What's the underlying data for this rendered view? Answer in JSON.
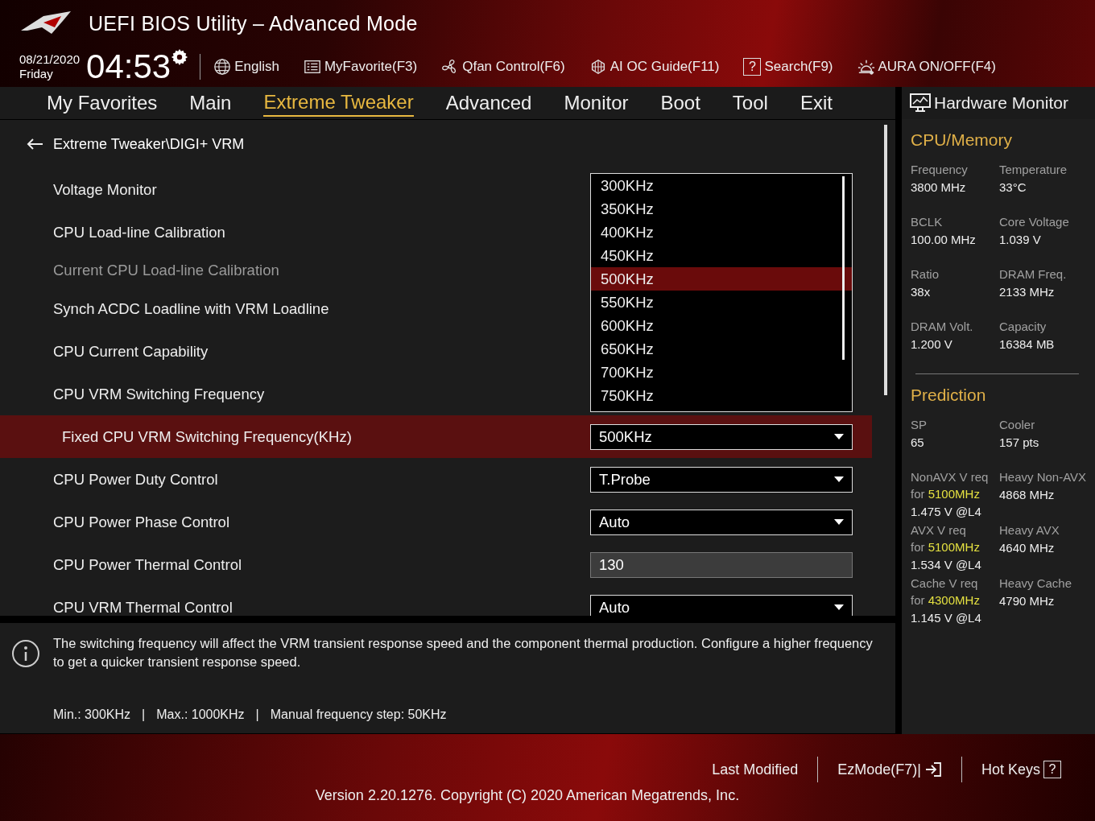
{
  "window": {
    "title": "UEFI BIOS Utility – Advanced Mode"
  },
  "clock": {
    "date": "08/21/2020",
    "day": "Friday",
    "time": "04:53"
  },
  "toolbar": [
    {
      "label": "English"
    },
    {
      "label": "MyFavorite(F3)"
    },
    {
      "label": "Qfan Control(F6)"
    },
    {
      "label": "AI OC Guide(F11)"
    },
    {
      "label": "Search(F9)",
      "glyph": "?"
    },
    {
      "label": "AURA ON/OFF(F4)"
    }
  ],
  "tabs": [
    {
      "label": "My Favorites",
      "selected": false
    },
    {
      "label": "Main",
      "selected": false
    },
    {
      "label": "Extreme Tweaker",
      "selected": true
    },
    {
      "label": "Advanced",
      "selected": false
    },
    {
      "label": "Monitor",
      "selected": false
    },
    {
      "label": "Boot",
      "selected": false
    },
    {
      "label": "Tool",
      "selected": false
    },
    {
      "label": "Exit",
      "selected": false
    }
  ],
  "breadcrumb": "Extreme Tweaker\\DIGI+ VRM",
  "settings": [
    {
      "label": "Voltage Monitor",
      "kind": "hidden",
      "selected": false,
      "disabled": false
    },
    {
      "label": "CPU Load-line Calibration",
      "kind": "hidden",
      "selected": false,
      "disabled": false
    },
    {
      "label": "Current CPU Load-line Calibration",
      "kind": "hidden",
      "selected": false,
      "disabled": true
    },
    {
      "label": "Synch ACDC Loadline with VRM Loadline",
      "kind": "hidden",
      "selected": false,
      "disabled": false
    },
    {
      "label": "CPU Current Capability",
      "kind": "hidden",
      "selected": false,
      "disabled": false
    },
    {
      "label": "CPU VRM Switching Frequency",
      "kind": "hidden",
      "selected": false,
      "disabled": false
    },
    {
      "label": "Fixed CPU VRM Switching Frequency(KHz)",
      "kind": "dropdown",
      "value": "500KHz",
      "selected": true,
      "disabled": false
    },
    {
      "label": "CPU Power Duty Control",
      "kind": "dropdown",
      "value": "T.Probe",
      "selected": false,
      "disabled": false
    },
    {
      "label": "CPU Power Phase Control",
      "kind": "dropdown",
      "value": "Auto",
      "selected": false,
      "disabled": false
    },
    {
      "label": "CPU Power Thermal Control",
      "kind": "input",
      "value": "130",
      "selected": false,
      "disabled": false
    },
    {
      "label": "CPU VRM Thermal Control",
      "kind": "dropdown",
      "value": "Auto",
      "selected": false,
      "disabled": false
    }
  ],
  "dropdown_list": {
    "options": [
      {
        "label": "300KHz",
        "selected": false
      },
      {
        "label": "350KHz",
        "selected": false
      },
      {
        "label": "400KHz",
        "selected": false
      },
      {
        "label": "450KHz",
        "selected": false
      },
      {
        "label": "500KHz",
        "selected": true
      },
      {
        "label": "550KHz",
        "selected": false
      },
      {
        "label": "600KHz",
        "selected": false
      },
      {
        "label": "650KHz",
        "selected": false
      },
      {
        "label": "700KHz",
        "selected": false
      },
      {
        "label": "750KHz",
        "selected": false
      }
    ]
  },
  "help": {
    "text": "The switching frequency will affect the VRM transient response speed and the component thermal production. Configure a higher frequency to get a quicker transient response speed.",
    "limits": [
      "Min.: 300KHz",
      "Max.: 1000KHz",
      "Manual frequency step: 50KHz"
    ],
    "separator": "|"
  },
  "hardware_monitor": {
    "title": "Hardware Monitor",
    "cpu_memory": {
      "title": "CPU/Memory",
      "items": [
        {
          "label": "Frequency",
          "value": "3800 MHz"
        },
        {
          "label": "Temperature",
          "value": "33°C"
        },
        {
          "label": "BCLK",
          "value": "100.00 MHz"
        },
        {
          "label": "Core Voltage",
          "value": "1.039 V"
        },
        {
          "label": "Ratio",
          "value": "38x"
        },
        {
          "label": "DRAM Freq.",
          "value": "2133 MHz"
        },
        {
          "label": "DRAM Volt.",
          "value": "1.200 V"
        },
        {
          "label": "Capacity",
          "value": "16384 MB"
        }
      ]
    },
    "prediction": {
      "title": "Prediction",
      "items": [
        {
          "label": "SP",
          "value": "65"
        },
        {
          "label": "Cooler",
          "value": "157 pts"
        }
      ],
      "rows": [
        {
          "left": {
            "label": "NonAVX V req",
            "prefix": "for",
            "target": "5100MHz",
            "value": "1.475 V @L4"
          },
          "right": {
            "label": "Heavy Non-AVX",
            "value": "4868 MHz"
          }
        },
        {
          "left": {
            "label": "AVX V req",
            "prefix": "for",
            "target": "5100MHz",
            "value": "1.534 V @L4"
          },
          "right": {
            "label": "Heavy AVX",
            "value": "4640 MHz"
          }
        },
        {
          "left": {
            "label": "Cache V req",
            "prefix": "for",
            "target": "4300MHz",
            "value": "1.145 V @L4"
          },
          "right": {
            "label": "Heavy Cache",
            "value": "4790 MHz"
          }
        }
      ]
    }
  },
  "footer": {
    "links": [
      {
        "label": "Last Modified"
      },
      {
        "label": "EzMode(F7)|"
      },
      {
        "label": "Hot Keys",
        "glyph": "?"
      }
    ],
    "version": "Version 2.20.1276. Copyright (C) 2020 American Megatrends, Inc."
  }
}
